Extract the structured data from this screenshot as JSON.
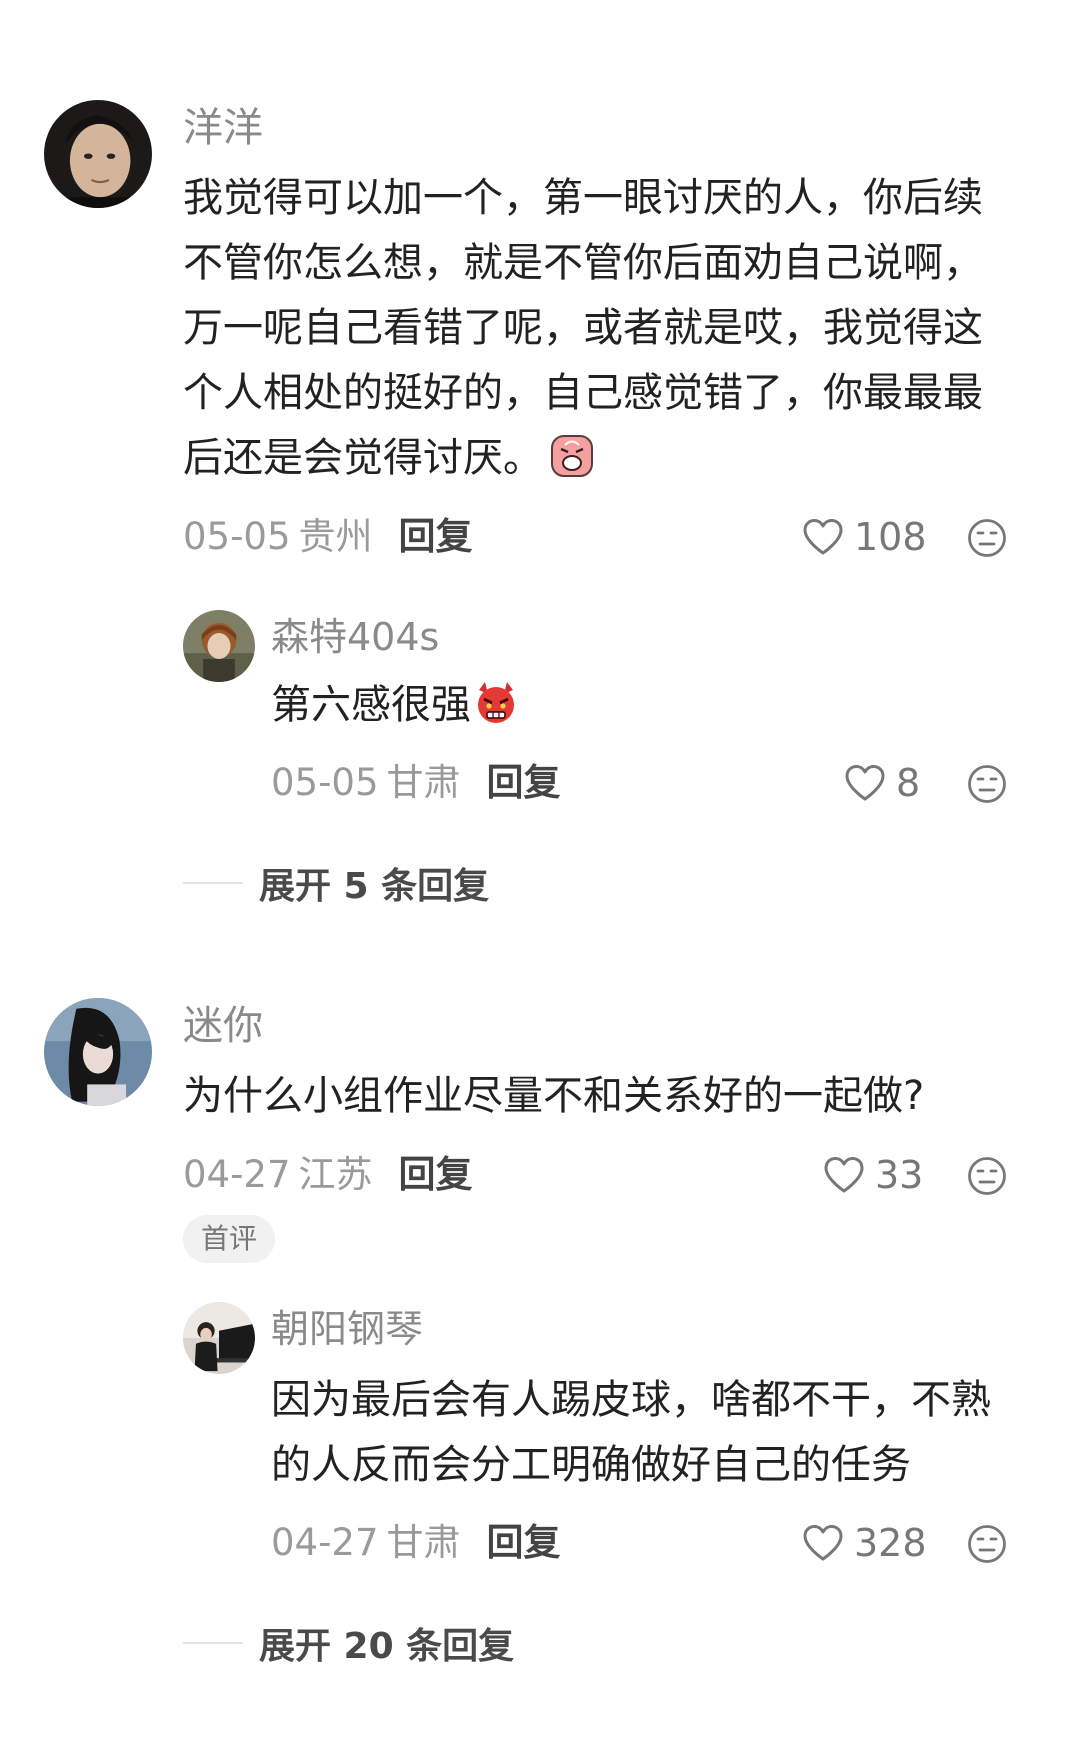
{
  "colors": {
    "username": "#8a8a8a",
    "text": "#222222",
    "meta": "#9a9a9a",
    "reply": "#444444",
    "icon": "#777777",
    "tag_bg": "#f1f1f1"
  },
  "comments": [
    {
      "username": "洋洋",
      "lines": [
        "我觉得可以加一个，第一眼讨厌的人，你后续",
        "不管你怎么想，就是不管你后面劝自己说啊，",
        "万一呢自己看错了呢，或者就是哎，我觉得这",
        "个人相处的挺好的，自己感觉错了，你最最最",
        "后还是会觉得讨厌。"
      ],
      "emoji": "crying-face-emoji",
      "date": "05-05",
      "location": "贵州",
      "reply_label": "回复",
      "likes": "108",
      "replies": [
        {
          "username": "森特404s",
          "text": "第六感很强",
          "emoji": "angry-devil-face-emoji",
          "date": "05-05",
          "location": "甘肃",
          "reply_label": "回复",
          "likes": "8"
        }
      ],
      "expand_label": "展开 5 条回复"
    },
    {
      "username": "迷你",
      "lines": [
        "为什么小组作业尽量不和关系好的一起做?"
      ],
      "date": "04-27",
      "location": "江苏",
      "reply_label": "回复",
      "likes": "33",
      "tag": "首评",
      "replies": [
        {
          "username": "朝阳钢琴",
          "lines": [
            "因为最后会有人踢皮球，啥都不干，不熟",
            "的人反而会分工明确做好自己的任务"
          ],
          "date": "04-27",
          "location": "甘肃",
          "reply_label": "回复",
          "likes": "328"
        }
      ],
      "expand_label": "展开 20 条回复"
    }
  ],
  "icons": {
    "like": "heart-outline-icon",
    "dislike": "meh-face-icon"
  }
}
